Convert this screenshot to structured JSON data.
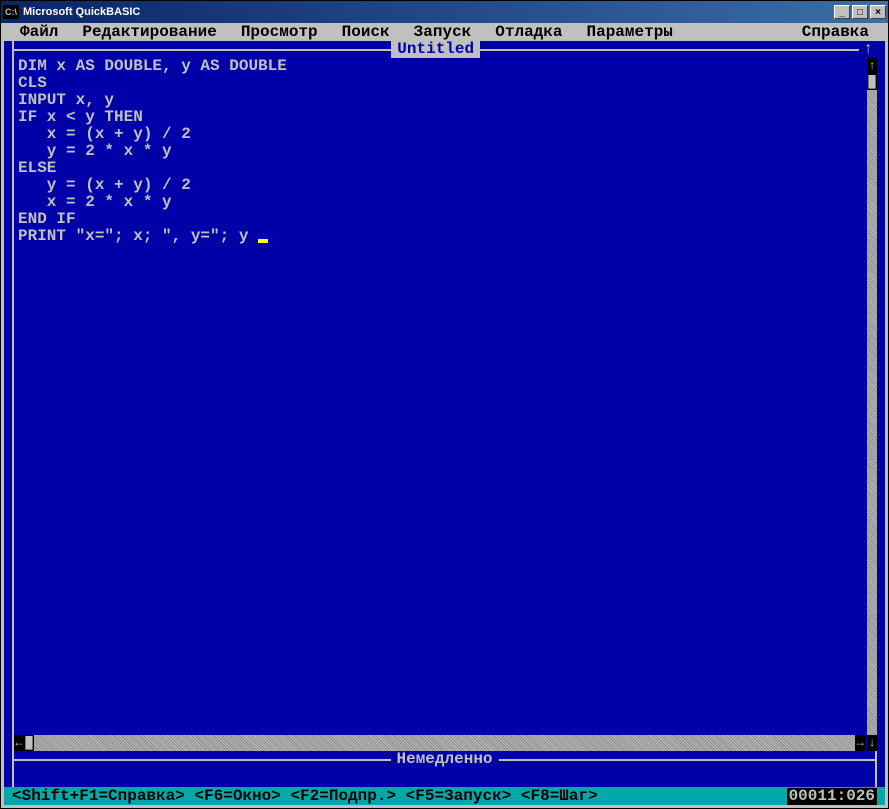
{
  "window": {
    "title": "Microsoft QuickBASIC",
    "icon_text": "C:\\"
  },
  "menubar": {
    "items": [
      "Файл",
      "Редактирование",
      "Просмотр",
      "Поиск",
      "Запуск",
      "Отладка",
      "Параметры",
      "Справка"
    ]
  },
  "editor": {
    "filename": "Untitled",
    "code_lines": [
      "DIM x AS DOUBLE, y AS DOUBLE",
      "CLS",
      "INPUT x, y",
      "IF x < y THEN",
      "   x = (x + y) / 2",
      "   y = 2 * x * y",
      "ELSE",
      "   y = (x + y) / 2",
      "   x = 2 * x * y",
      "END IF",
      "PRINT \"x=\"; x; \", y=\"; y"
    ]
  },
  "immediate": {
    "title": "Немедленно"
  },
  "statusbar": {
    "hints": "<Shift+F1=Справка> <F6=Окно> <F2=Подпр.> <F5=Запуск> <F8=Шаг>",
    "position": "00011:026"
  }
}
